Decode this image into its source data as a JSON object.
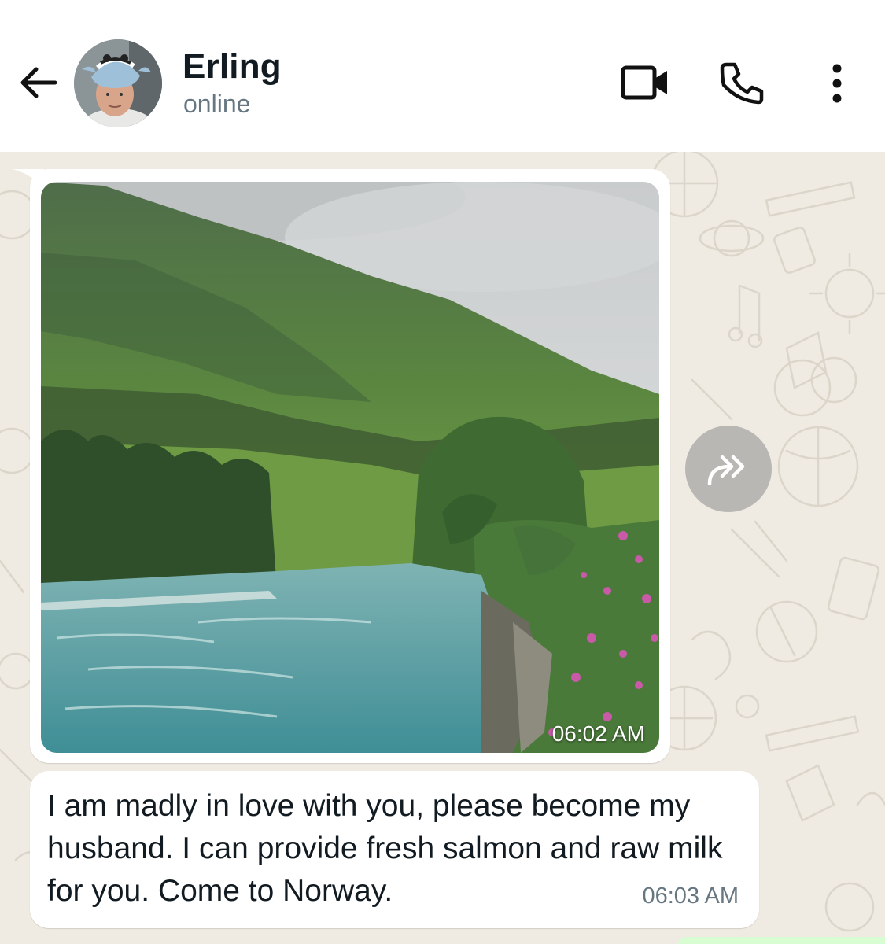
{
  "header": {
    "name": "Erling",
    "status": "online",
    "icons": {
      "back": "arrow-left-icon",
      "video": "video-camera-icon",
      "call": "phone-icon",
      "menu": "more-vertical-icon"
    }
  },
  "messages": [
    {
      "type": "image",
      "time": "06:02 AM",
      "image_subject": "mountain river landscape"
    },
    {
      "type": "text",
      "text": "I am madly in love with you, please become my husband. I can provide fresh salmon and raw milk for you. Come to Norway.",
      "time": "06:03 AM"
    }
  ],
  "forward_icon": "forward-icon",
  "colors": {
    "chat_background": "#efeae2",
    "bubble": "#ffffff",
    "outgoing_bubble": "#d9fdd3",
    "primary_text": "#111b21",
    "secondary_text": "#667781"
  }
}
